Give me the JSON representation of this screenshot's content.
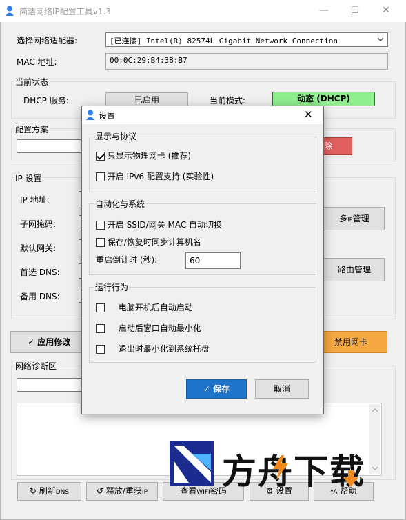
{
  "window": {
    "title": "简洁网络IP配置工具v1.3",
    "minimize": "—",
    "maximize": "☐",
    "close": "✕"
  },
  "adapter": {
    "label": "选择网络适配器:",
    "value": "[已连接] Intel(R) 82574L Gigabit Network Connection",
    "mac_label": "MAC 地址:",
    "mac_value": "00:0C:29:B4:38:B7"
  },
  "status": {
    "group": "当前状态",
    "dhcp_label": "DHCP 服务:",
    "dhcp_value": "已启用",
    "mode_label": "当前模式:",
    "mode_value": "动态 (DHCP)",
    "mode_color": "#90ee90"
  },
  "profile": {
    "group": "配置方案",
    "delete_tail": "除",
    "delete_color": "#e06060"
  },
  "ip": {
    "group": "IP 设置",
    "ip_label": "IP 地址:",
    "mask_label": "子网掩码:",
    "gateway_label": "默认网关:",
    "dns1_label": "首选 DNS:",
    "dns2_label": "备用 DNS:",
    "multi_ip_prefix": "多",
    "multi_ip_small": "IP",
    "multi_ip_suffix": "管理",
    "route_button": "路由管理"
  },
  "actions": {
    "apply": "应用修改",
    "disable_nic": "禁用网卡",
    "disable_color": "#f5a742"
  },
  "diag": {
    "group": "网络诊断区"
  },
  "bottom": {
    "flush_dns": "刷新",
    "flush_dns_small": "DNS",
    "release": "释放/重获",
    "release_small": "IP",
    "wifi": "查看",
    "wifi_small": "WIFI",
    "wifi_tail": "密码",
    "settings": "设置",
    "help": "帮助"
  },
  "dialog": {
    "title": "设置",
    "close": "✕",
    "sec1": "显示与协议",
    "opt_physical": "只显示物理网卡 (推荐)",
    "opt_ipv6": "开启 IPv6 配置支持 (实验性)",
    "sec2": "自动化与系统",
    "opt_ssid": "开启 SSID/网关 MAC 自动切换",
    "opt_hostname": "保存/恢复时同步计算机名",
    "countdown_label": "重启倒计时 (秒):",
    "countdown_value": "60",
    "sec3": "运行行为",
    "opt_autostart": "电脑开机后自动启动",
    "opt_minimize_start": "启动后窗口自动最小化",
    "opt_tray": "退出时最小化到系统托盘",
    "save": "保存",
    "cancel": "取消",
    "save_color": "#1f74c9",
    "checked": {
      "physical": true,
      "ipv6": false,
      "ssid": false,
      "hostname": false,
      "autostart": false,
      "minimize_start": false,
      "tray": false
    }
  },
  "watermark": {
    "text": "方舟下载"
  }
}
